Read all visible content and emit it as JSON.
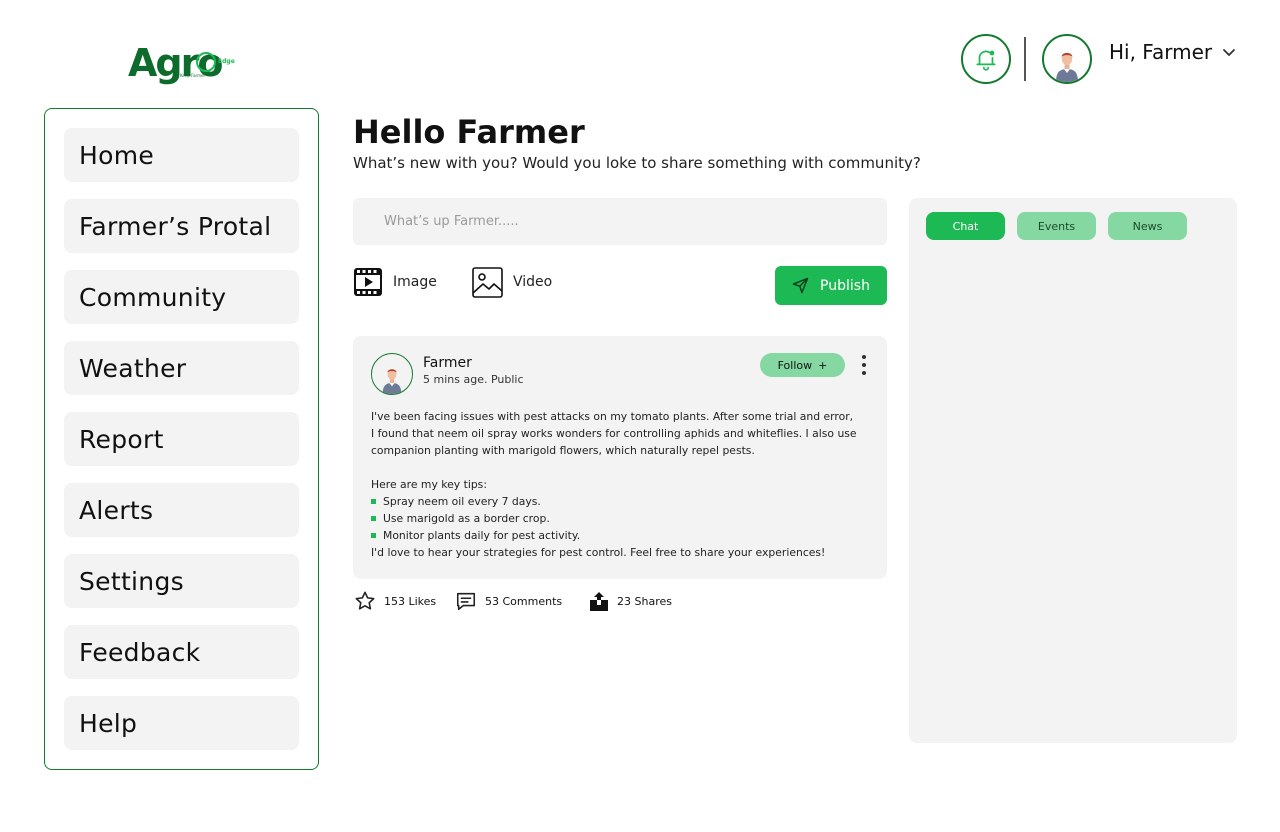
{
  "logo": {
    "text": "Agro",
    "edge": "Edge",
    "tagline": "Keep Farmer"
  },
  "header": {
    "greeting": "Hi, Farmer",
    "bell_icon": "bell-notification-icon",
    "chevron_icon": "chevron-down-icon"
  },
  "sidebar": {
    "items": [
      {
        "label": "Home"
      },
      {
        "label": "Farmer’s Protal"
      },
      {
        "label": "Community"
      },
      {
        "label": "Weather"
      },
      {
        "label": "Report"
      },
      {
        "label": "Alerts"
      },
      {
        "label": "Settings"
      },
      {
        "label": "Feedback"
      },
      {
        "label": "Help"
      }
    ]
  },
  "main": {
    "title": "Hello Farmer",
    "subtitle": "What’s new with you? Would you loke to share something with community?",
    "composer": {
      "placeholder": "What’s up Farmer.....",
      "image_label": "Image",
      "video_label": "Video",
      "publish_label": "Publish"
    },
    "post": {
      "author": "Farmer",
      "meta": "5 mins age. Public",
      "follow_label": "Follow",
      "follow_icon": "+",
      "lines": [
        "I've been facing issues with pest attacks on my tomato plants. After some trial and error,",
        "I found that neem oil spray works wonders for controlling aphids and whiteflies. I also use",
        "companion planting with marigold flowers, which naturally repel pests."
      ],
      "tips_heading": "Here are my key tips:",
      "tips": [
        "Spray neem oil every 7 days.",
        "Use marigold as a border crop.",
        "Monitor plants daily for pest activity."
      ],
      "closing": "I'd love to hear your strategies for pest control. Feel free to share your experiences!",
      "likes": "153 Likes",
      "comments": "53 Comments",
      "shares": "23 Shares"
    }
  },
  "right_panel": {
    "tabs": [
      {
        "label": "Chat"
      },
      {
        "label": "Events"
      },
      {
        "label": "News"
      }
    ]
  },
  "colors": {
    "primary": "#1db954",
    "primary_light": "#86d8a3",
    "dark_green": "#137a2e",
    "surface": "#f3f3f3"
  }
}
